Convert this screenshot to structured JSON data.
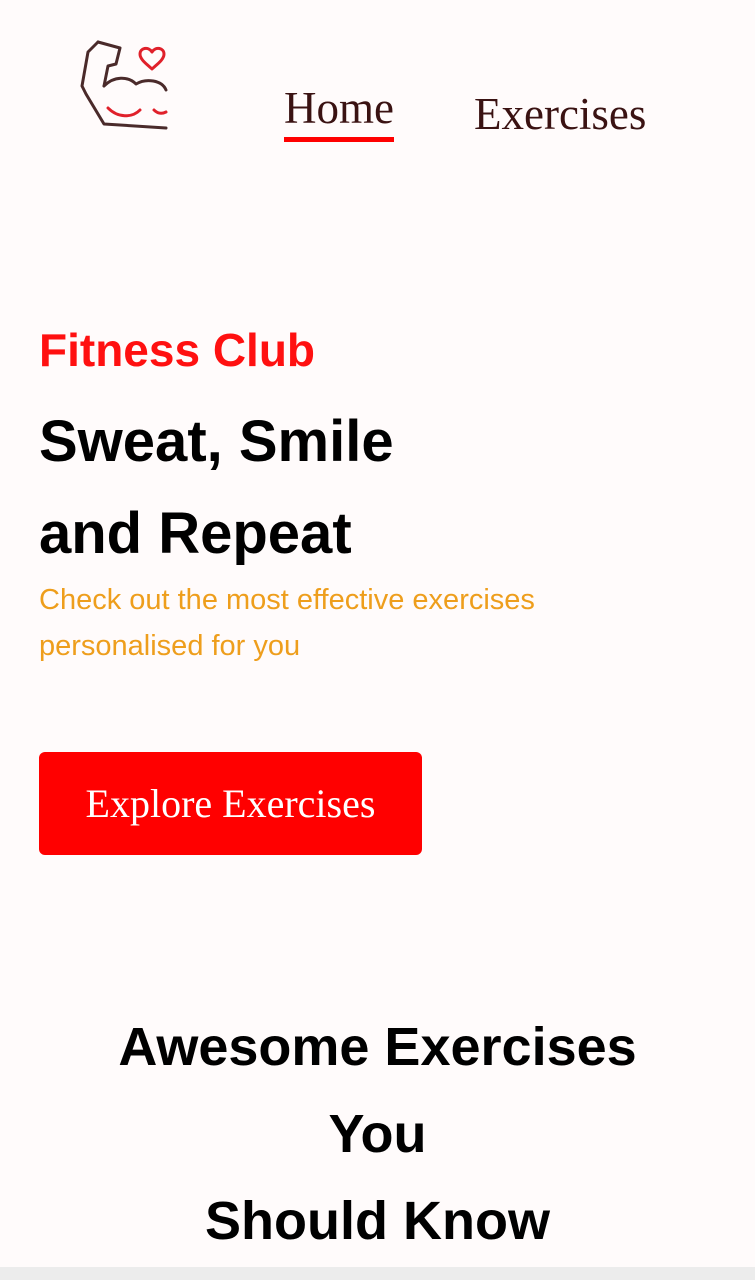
{
  "nav": {
    "logo_icon": "flexed-arm-heart-icon",
    "links": [
      {
        "label": "Home",
        "active": true
      },
      {
        "label": "Exercises",
        "active": false
      }
    ]
  },
  "hero": {
    "eyebrow": "Fitness Club",
    "title_lines": [
      "Sweat, Smile",
      "and Repeat"
    ],
    "description_lines": [
      "Check out the most effective exercises",
      "personalised for you"
    ],
    "button_label": "Explore Exercises"
  },
  "section": {
    "title_lines": [
      "Awesome Exercises",
      "You",
      "Should Know"
    ]
  },
  "colors": {
    "accent": "#ff0000",
    "nav_text": "#3a1212",
    "subtitle": "#ee9e1c",
    "background": "#fffbfb"
  }
}
